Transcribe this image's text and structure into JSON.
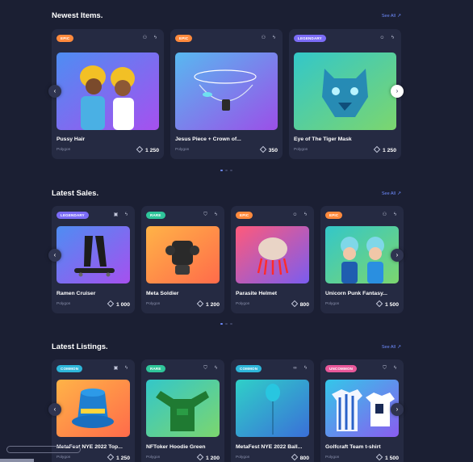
{
  "sections": {
    "newest": {
      "title": "Newest Items.",
      "see_all": "See All",
      "items": [
        {
          "badge": "EPIC",
          "badge_color": "#ff8a3d",
          "name": "Pussy Hair",
          "chain": "Polygon",
          "price": "1 250",
          "art_icon": "cat-hair-pair"
        },
        {
          "badge": "EPIC",
          "badge_color": "#ff8a3d",
          "name": "Jesus Piece + Crown of...",
          "chain": "Polygon",
          "price": "350",
          "art_icon": "crown-necklace"
        },
        {
          "badge": "LEGENDARY",
          "badge_color": "#7b6cf6",
          "name": "Eye of The Tiger Mask",
          "chain": "Polygon",
          "price": "1 250",
          "art_icon": "tiger-mask"
        }
      ]
    },
    "sales": {
      "title": "Latest Sales.",
      "see_all": "See All",
      "items": [
        {
          "badge": "LEGENDARY",
          "badge_color": "#7b6cf6",
          "name": "Ramen Cruiser",
          "chain": "Polygon",
          "price": "1 000",
          "art_icon": "skateboard-legs"
        },
        {
          "badge": "RARE",
          "badge_color": "#2fc59a",
          "name": "Meta Soldier",
          "chain": "Polygon",
          "price": "1 200",
          "art_icon": "soldier-armor"
        },
        {
          "badge": "EPIC",
          "badge_color": "#ff8a3d",
          "name": "Parasite Helmet",
          "chain": "Polygon",
          "price": "800",
          "art_icon": "parasite-helmet"
        },
        {
          "badge": "EPIC",
          "badge_color": "#ff8a3d",
          "name": "Unicorn Punk Fantasy...",
          "chain": "Polygon",
          "price": "1 500",
          "art_icon": "unicorn-punk"
        }
      ]
    },
    "listings": {
      "title": "Latest Listings.",
      "see_all": "See All",
      "items": [
        {
          "badge": "COMMON",
          "badge_color": "#2eb6d9",
          "name": "MetaFest NYE 2022 Top...",
          "chain": "Polygon",
          "price": "1 250",
          "art_icon": "party-hat"
        },
        {
          "badge": "RARE",
          "badge_color": "#2fc59a",
          "name": "NFToker Hoodie Green",
          "chain": "Polygon",
          "price": "1 200",
          "art_icon": "green-hoodie"
        },
        {
          "badge": "COMMON",
          "badge_color": "#2eb6d9",
          "name": "MetaFest NYE 2022 Ball...",
          "chain": "Polygon",
          "price": "800",
          "art_icon": "balloon"
        },
        {
          "badge": "UNCOMMON",
          "badge_color": "#e8589a",
          "name": "Golfcraft Team t-shirt",
          "chain": "Polygon",
          "price": "1 500",
          "art_icon": "team-shirt"
        }
      ]
    }
  }
}
